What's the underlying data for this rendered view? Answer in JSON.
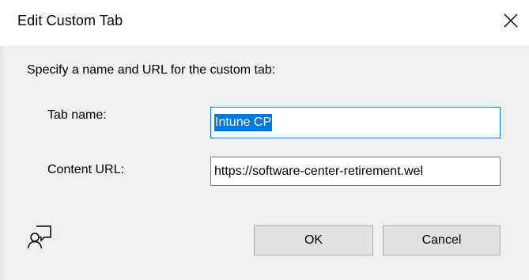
{
  "window": {
    "title": "Edit Custom Tab",
    "close_icon": "close-icon"
  },
  "form": {
    "intro": "Specify a name and URL for the custom tab:",
    "tab_name_label": "Tab name:",
    "tab_name_value": "Intune CP",
    "content_url_label": "Content URL:",
    "content_url_value": "https://software-center-retirement.wel"
  },
  "footer": {
    "help_icon": "user-feedback-icon",
    "ok_label": "OK",
    "cancel_label": "Cancel"
  },
  "colors": {
    "selection": "#0078d7",
    "dialog_background": "#f0f0f0",
    "button_background": "#e1e1e1"
  }
}
